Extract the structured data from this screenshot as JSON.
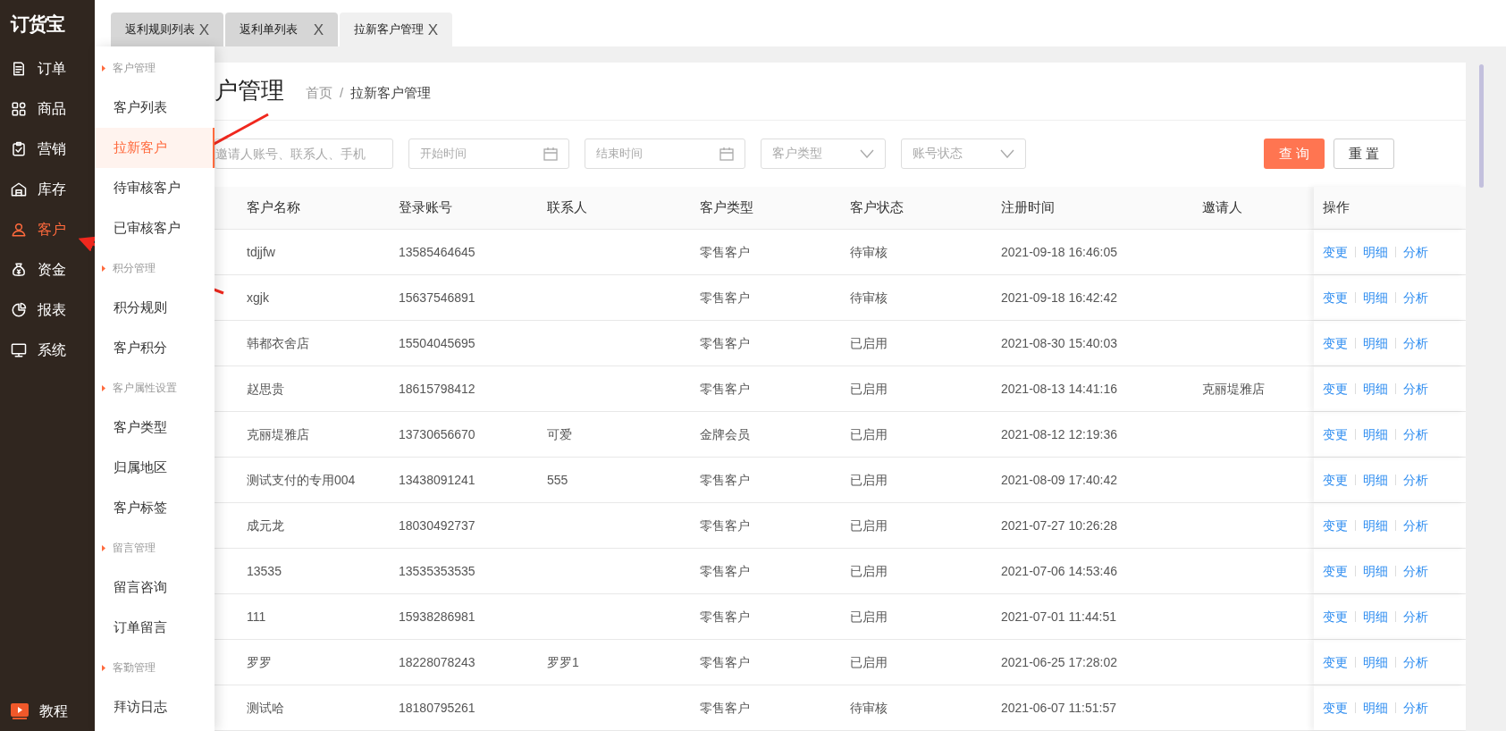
{
  "logo": "订货宝",
  "nav": [
    {
      "label": "订单",
      "selected": false
    },
    {
      "label": "商品",
      "selected": false
    },
    {
      "label": "营销",
      "selected": false
    },
    {
      "label": "库存",
      "selected": false
    },
    {
      "label": "客户",
      "selected": true
    },
    {
      "label": "资金",
      "selected": false
    },
    {
      "label": "报表",
      "selected": false
    },
    {
      "label": "系统",
      "selected": false
    }
  ],
  "nav_bottom": {
    "label": "教程"
  },
  "tabs": [
    {
      "label": "返利规则列表",
      "close": "X",
      "selected": false
    },
    {
      "label": "返利单列表",
      "close": "X",
      "selected": false
    },
    {
      "label": "拉新客户管理",
      "close": "X",
      "selected": true
    }
  ],
  "submenu": [
    {
      "kind": "group",
      "label": "客户管理"
    },
    {
      "kind": "item",
      "label": "客户列表",
      "selected": false
    },
    {
      "kind": "item",
      "label": "拉新客户",
      "selected": true
    },
    {
      "kind": "item",
      "label": "待审核客户",
      "selected": false
    },
    {
      "kind": "item",
      "label": "已审核客户",
      "selected": false
    },
    {
      "kind": "group",
      "label": "积分管理"
    },
    {
      "kind": "item",
      "label": "积分规则",
      "selected": false
    },
    {
      "kind": "item",
      "label": "客户积分",
      "selected": false
    },
    {
      "kind": "group",
      "label": "客户属性设置"
    },
    {
      "kind": "item",
      "label": "客户类型",
      "selected": false
    },
    {
      "kind": "item",
      "label": "归属地区",
      "selected": false
    },
    {
      "kind": "item",
      "label": "客户标签",
      "selected": false
    },
    {
      "kind": "group",
      "label": "留言管理"
    },
    {
      "kind": "item",
      "label": "留言咨询",
      "selected": false
    },
    {
      "kind": "item",
      "label": "订单留言",
      "selected": false
    },
    {
      "kind": "group",
      "label": "客勤管理"
    },
    {
      "kind": "item",
      "label": "拜访日志",
      "selected": false
    }
  ],
  "page_title": "户管理",
  "breadcrumb": [
    "首页",
    "/",
    "拉新客户管理"
  ],
  "filters": [
    {
      "kind": "text",
      "placeholder": "邀请人账号、联系人、手机"
    },
    {
      "kind": "date",
      "placeholder": "开始时间"
    },
    {
      "kind": "date",
      "placeholder": "结束时间"
    },
    {
      "kind": "select",
      "placeholder": "客户类型"
    },
    {
      "kind": "select",
      "placeholder": "账号状态"
    }
  ],
  "buttons": [
    {
      "label": "查 询",
      "primary": true
    },
    {
      "label": "重 置",
      "primary": false
    }
  ],
  "table": {
    "columns": [
      "客户名称",
      "登录账号",
      "联系人",
      "客户类型",
      "客户状态",
      "注册时间",
      "邀请人",
      "操作"
    ],
    "rows": [
      {
        "cells": [
          "tdjjfw",
          "13585464645",
          "",
          "零售客户",
          "待审核",
          "2021-09-18 16:46:05",
          ""
        ],
        "actions": [
          "变更",
          "明细",
          "分析"
        ]
      },
      {
        "cells": [
          "xgjk",
          "15637546891",
          "",
          "零售客户",
          "待审核",
          "2021-09-18 16:42:42",
          ""
        ],
        "actions": [
          "变更",
          "明细",
          "分析"
        ]
      },
      {
        "cells": [
          "韩都衣舍店",
          "15504045695",
          "",
          "零售客户",
          "已启用",
          "2021-08-30 15:40:03",
          ""
        ],
        "actions": [
          "变更",
          "明细",
          "分析"
        ]
      },
      {
        "cells": [
          "赵思贵",
          "18615798412",
          "",
          "零售客户",
          "已启用",
          "2021-08-13 14:41:16",
          "克丽堤雅店"
        ],
        "actions": [
          "变更",
          "明细",
          "分析"
        ]
      },
      {
        "cells": [
          "克丽堤雅店",
          "13730656670",
          "可爱",
          "金牌会员",
          "已启用",
          "2021-08-12 12:19:36",
          ""
        ],
        "actions": [
          "变更",
          "明细",
          "分析"
        ]
      },
      {
        "cells": [
          "测试支付的专用004",
          "13438091241",
          "555",
          "零售客户",
          "已启用",
          "2021-08-09 17:40:42",
          ""
        ],
        "actions": [
          "变更",
          "明细",
          "分析"
        ]
      },
      {
        "cells": [
          "成元龙",
          "18030492737",
          "",
          "零售客户",
          "已启用",
          "2021-07-27 10:26:28",
          ""
        ],
        "actions": [
          "变更",
          "明细",
          "分析"
        ]
      },
      {
        "cells": [
          "13535",
          "13535353535",
          "",
          "零售客户",
          "已启用",
          "2021-07-06 14:53:46",
          ""
        ],
        "actions": [
          "变更",
          "明细",
          "分析"
        ]
      },
      {
        "cells": [
          "111",
          "15938286981",
          "",
          "零售客户",
          "已启用",
          "2021-07-01 11:44:51",
          ""
        ],
        "actions": [
          "变更",
          "明细",
          "分析"
        ]
      },
      {
        "cells": [
          "罗罗",
          "18228078243",
          "罗罗1",
          "零售客户",
          "已启用",
          "2021-06-25 17:28:02",
          ""
        ],
        "actions": [
          "变更",
          "明细",
          "分析"
        ]
      },
      {
        "cells": [
          "测试哈",
          "18180795261",
          "",
          "零售客户",
          "待审核",
          "2021-06-07 11:51:57",
          ""
        ],
        "actions": [
          "变更",
          "明细",
          "分析"
        ]
      }
    ]
  }
}
